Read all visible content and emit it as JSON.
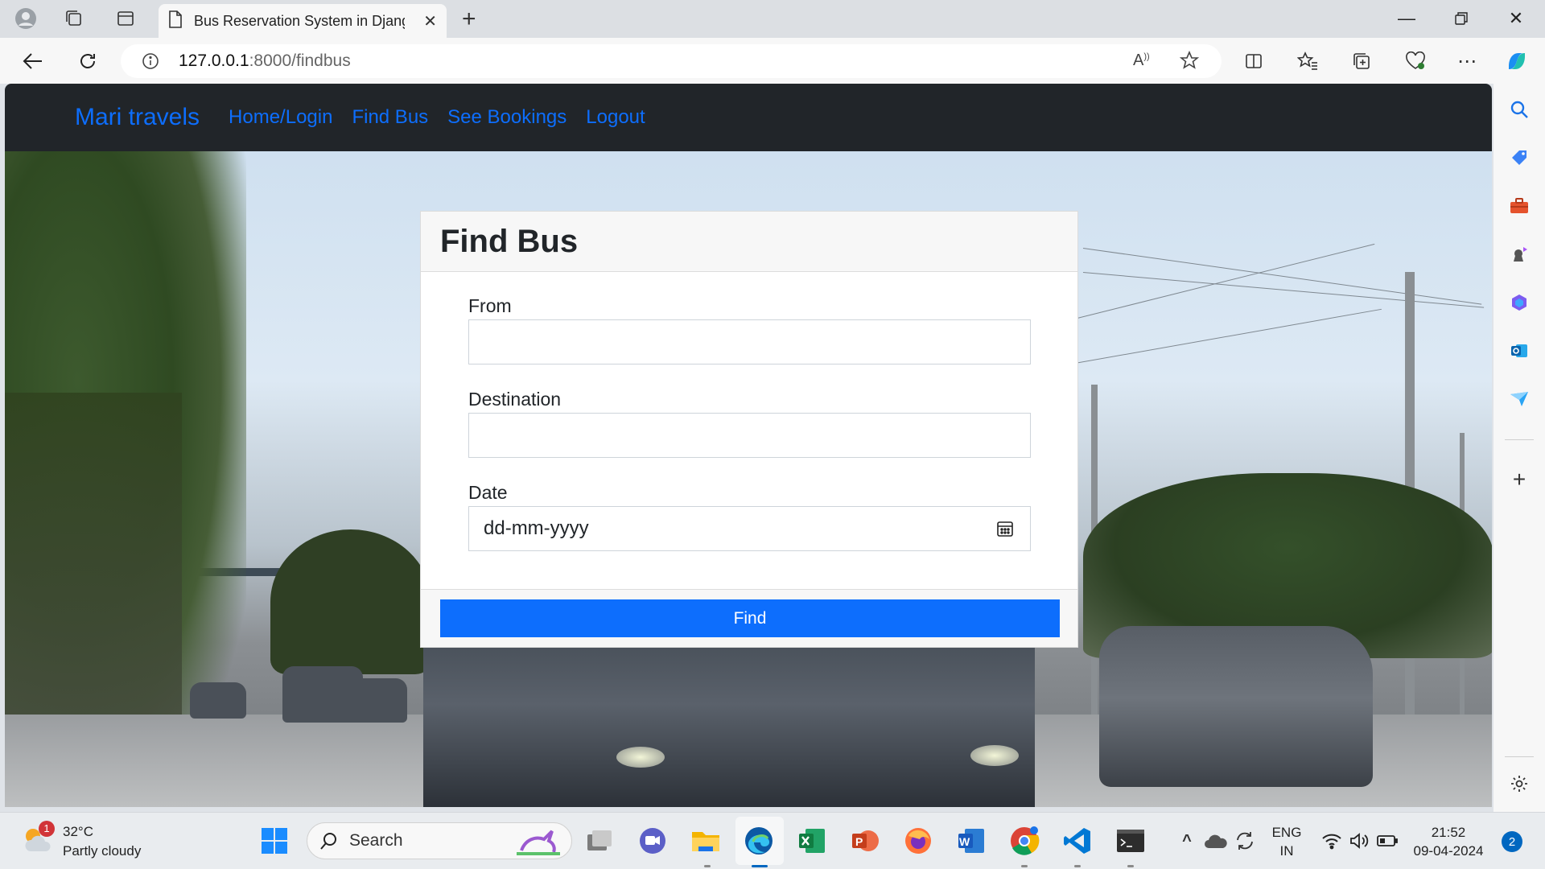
{
  "browser": {
    "tab_title": "Bus Reservation System in Djang",
    "url_host": "127.0.0.1",
    "url_path": ":8000/findbus"
  },
  "navbar": {
    "brand": "Mari travels",
    "links": [
      "Home/Login",
      "Find Bus",
      "See Bookings",
      "Logout"
    ]
  },
  "form": {
    "title": "Find Bus",
    "from_label": "From",
    "from_value": "",
    "destination_label": "Destination",
    "destination_value": "",
    "date_label": "Date",
    "date_placeholder": "dd-mm-yyyy",
    "submit_label": "Find"
  },
  "taskbar": {
    "weather_temp": "32°C",
    "weather_desc": "Partly cloudy",
    "weather_badge": "1",
    "search_placeholder": "Search",
    "lang_line1": "ENG",
    "lang_line2": "IN",
    "time": "21:52",
    "date": "09-04-2024",
    "notification_count": "2"
  },
  "colors": {
    "brand_blue": "#0d6efd",
    "navbar_bg": "#212529",
    "button_bg": "#0d6efd"
  }
}
